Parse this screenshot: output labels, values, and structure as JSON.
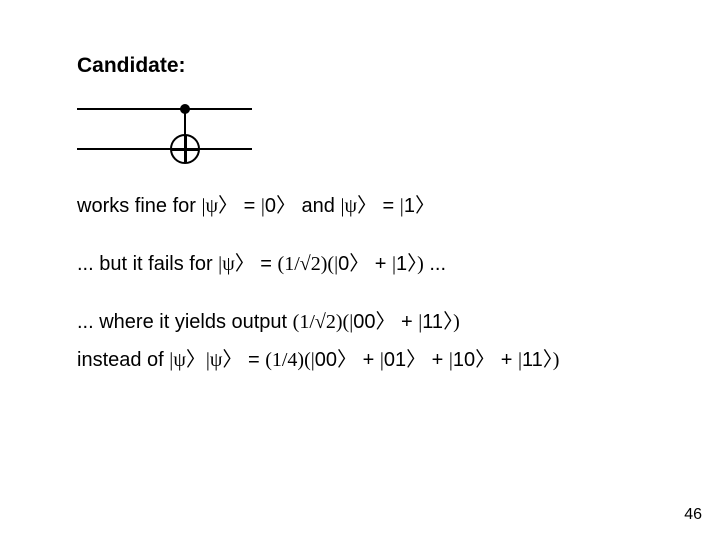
{
  "title": "Candidate:",
  "lines": {
    "works_pre": "works fine for ",
    "eq": " = ",
    "and": " and ",
    "zero": "0",
    "one": "1",
    "fails_pre": "... but it fails for ",
    "fails_rhs_open": "(",
    "one_serif": "1",
    "slash": "/",
    "root": "√",
    "two_serif": "2",
    "close_paren_open_br": ")(",
    "plus": " + ",
    "close_state": ")",
    "ellipsis": " ...",
    "where_pre": "... where it yields output ",
    "dbl00": "00",
    "dbl11": "11",
    "instead_pre": "instead of ",
    "quarter_open": "(",
    "quarter_num": "1",
    "quarter_slash": "/",
    "quarter_den": "4",
    "quarter_close": ")(",
    "dbl01": "01",
    "dbl10": "10"
  },
  "glyphs": {
    "bar": "|",
    "ket": "〉",
    "psi": "ψ"
  },
  "page_number": "46"
}
